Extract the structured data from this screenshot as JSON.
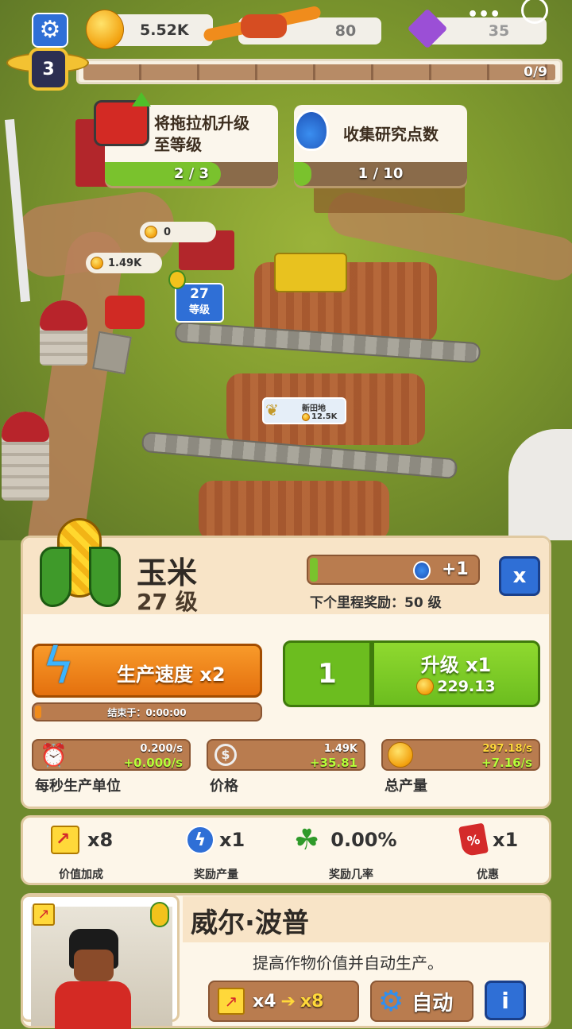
{
  "hud": {
    "coins": "5.52K",
    "mid_value": "80",
    "gems": "35",
    "level": "3",
    "xp": "0/9"
  },
  "quests": [
    {
      "text_line1": "将拖拉机升级",
      "text_line2": "至等级",
      "progress": "2 / 3",
      "fraction": 0.67
    },
    {
      "text_line1": "收集研究点数",
      "text_line2": "",
      "progress": "1 / 10",
      "fraction": 0.1
    }
  ],
  "world": {
    "bubble_zero": "0",
    "bubble_coins": "1.49K",
    "field_level": "27",
    "field_level_label": "等级",
    "new_field_label": "新田地",
    "new_field_cost": "12.5K"
  },
  "crop": {
    "name": "玉米",
    "level_text": "27 级",
    "milestone_reward": "+1",
    "milestone_text": "下个里程奖励：",
    "milestone_level": "50 级",
    "milestone_fraction": 0.04,
    "close_label": "x"
  },
  "boost": {
    "label": "生产速度 x2",
    "ends_text": "结束于：0:00:00"
  },
  "upgrade": {
    "quantity": "1",
    "label": "升级 x1",
    "cost": "229.13"
  },
  "stats": [
    {
      "v1": "0.200/s",
      "v2": "+0.000/s",
      "label": "每秒生产单位",
      "icon": "alarm-clock-icon"
    },
    {
      "v1": "1.49K",
      "v2": "+35.81",
      "label": "价格",
      "icon": "price-up-icon"
    },
    {
      "v1": "297.18/s",
      "v2": "+7.16/s",
      "label": "总产量",
      "icon": "coin-icon"
    }
  ],
  "bonuses": [
    {
      "value": "x8",
      "label": "价值加成",
      "icon": "chart-icon"
    },
    {
      "value": "x1",
      "label": "奖励产量",
      "icon": "lightning-icon"
    },
    {
      "value": "0.00%",
      "label": "奖励几率",
      "icon": "clover-icon"
    },
    {
      "value": "x1",
      "label": "优惠",
      "icon": "discount-tag-icon"
    }
  ],
  "manager": {
    "name": "威尔·波普",
    "description": "提高作物价值并自动生产。",
    "mult_from": "x4",
    "mult_to": "x8",
    "auto_label": "自动",
    "info_label": "i"
  },
  "colors": {
    "accent_orange": "#f08c1c",
    "accent_green": "#7ac22d",
    "panel_bg": "#fdf6e9",
    "blue_button": "#2f6fd6"
  }
}
